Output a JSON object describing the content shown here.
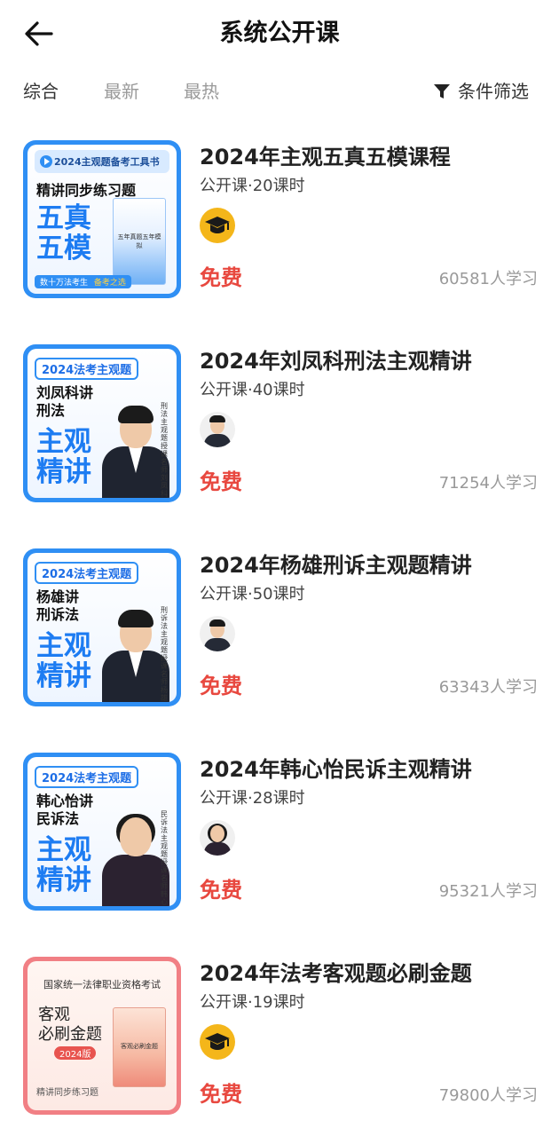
{
  "header": {
    "title": "系统公开课"
  },
  "filter": {
    "tabs": [
      {
        "label": "综合",
        "active": true
      },
      {
        "label": "最新",
        "active": false
      },
      {
        "label": "最热",
        "active": false
      }
    ],
    "filter_label": "条件筛选"
  },
  "courses": [
    {
      "title": "2024年主观五真五模课程",
      "meta": "公开课·20课时",
      "price": "免费",
      "learners": "60581人学习",
      "cover": {
        "style": "blue-book",
        "banner": "2024主观题备考工具书",
        "subtitle": "精讲同步练习题",
        "big": "五真\n五模",
        "book_caption": "五年真题五年模拟",
        "foot_left": "数十万法考生",
        "foot_right": "备考之选"
      },
      "avatar": "hat-icon"
    },
    {
      "title": "2024年刘凤科刑法主观精讲",
      "meta": "公开课·40课时",
      "price": "免费",
      "learners": "71254人学习",
      "cover": {
        "style": "blue-person",
        "tag": "2024法考主观题",
        "subtitle": "刘凤科讲\n刑法",
        "big": "主观\n精讲",
        "side_text": "刑法主观题授课名师刘凤科",
        "person": "male"
      },
      "avatar": "teacher-photo"
    },
    {
      "title": "2024年杨雄刑诉主观题精讲",
      "meta": "公开课·50课时",
      "price": "免费",
      "learners": "63343人学习",
      "cover": {
        "style": "blue-person",
        "tag": "2024法考主观题",
        "subtitle": "杨雄讲\n刑诉法",
        "big": "主观\n精讲",
        "side_text": "刑诉法主观题授课名师杨雄",
        "person": "male"
      },
      "avatar": "teacher-photo"
    },
    {
      "title": "2024年韩心怡民诉主观精讲",
      "meta": "公开课·28课时",
      "price": "免费",
      "learners": "95321人学习",
      "cover": {
        "style": "blue-person",
        "tag": "2024法考主观题",
        "subtitle": "韩心怡讲\n民诉法",
        "big": "主观\n精讲",
        "side_text": "民诉法主观题授课名师韩心怡",
        "person": "female"
      },
      "avatar": "teacher-photo"
    },
    {
      "title": "2024年法考客观题必刷金题",
      "meta": "公开课·19课时",
      "price": "免费",
      "learners": "79800人学习",
      "cover": {
        "style": "pink-book",
        "exam_title": "国家统一法律职业资格考试",
        "big": "客观\n必刷金题",
        "year": "2024版",
        "foot": "精讲同步练习题",
        "book_caption": "客观必刷金题"
      },
      "avatar": "hat-icon"
    }
  ],
  "colors": {
    "accent_blue": "#2f8ff4",
    "price_red": "#e8483f",
    "muted": "#999999"
  }
}
